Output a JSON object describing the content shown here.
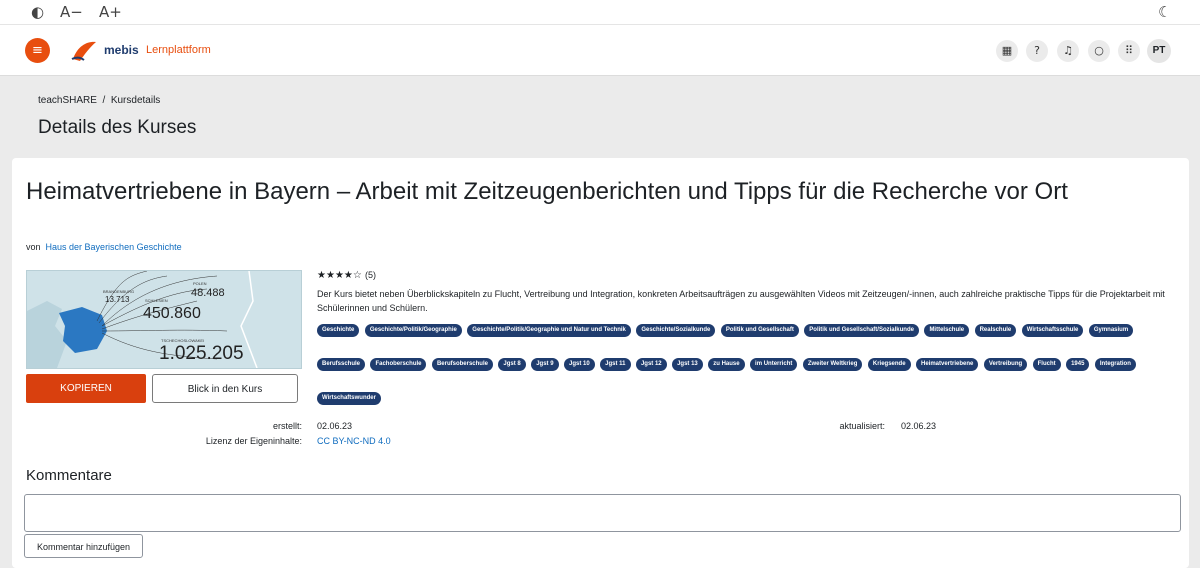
{
  "a11y": {
    "contrast_icon": "contrast-icon",
    "font_down": "A−",
    "font_up": "A+",
    "dark_mode_icon": "moon-icon"
  },
  "nav": {
    "menu_icon": "hamburger-icon",
    "brand": "mebis",
    "brand_sub": "Lernplattform",
    "icons": [
      "qr-code-icon",
      "help-icon",
      "bell-icon",
      "chat-icon",
      "apps-grid-icon"
    ],
    "user_initials": "PT"
  },
  "breadcrumb": {
    "first": "teachSHARE",
    "separator": "/",
    "current": "Kursdetails"
  },
  "page_title": "Details des Kurses",
  "course": {
    "title": "Heimatvertriebene in Bayern – Arbeit mit Zeitzeugenberichten und Tipps für die Recherche vor Ort",
    "by_label": "von",
    "author": "Haus der Bayerischen Geschichte",
    "thumbnail": {
      "labels": [
        "BRANDENBURG",
        "13.713",
        "POLEN",
        "48.488",
        "SCHLESIEN",
        "450.860",
        "TSCHECHOSLOWAKEI",
        "1.025.205"
      ]
    },
    "rating": {
      "value": 4,
      "max": 5,
      "count_text": "(5)"
    },
    "description": "Der Kurs bietet neben Überblickskapiteln zu Flucht, Vertreibung und Integration, konkreten Arbeitsaufträgen zu ausgewählten Videos mit Zeitzeugen/-innen, auch zahlreiche praktische Tipps für die Projektarbeit mit Schülerinnen und Schülern.",
    "tags": [
      "Geschichte",
      "Geschichte/Politik/Geographie",
      "Geschichte/Politik/Geographie und Natur und Technik",
      "Geschichte/Sozialkunde",
      "Politik und Gesellschaft",
      "Politik und Gesellschaft/Sozialkunde",
      "Mittelschule",
      "Realschule",
      "Wirtschaftsschule",
      "Gymnasium",
      "Berufsschule",
      "Fachoberschule",
      "Berufsoberschule",
      "Jgst 8",
      "Jgst 9",
      "Jgst 10",
      "Jgst 11",
      "Jgst 12",
      "Jgst 13",
      "zu Hause",
      "im Unterricht",
      "Zweiter Weltkrieg",
      "Kriegsende",
      "Heimatvertriebene",
      "Vertreibung",
      "Flucht",
      "1945",
      "Integration",
      "Wirtschaftswunder"
    ],
    "copy_button": "KOPIEREN",
    "view_button": "Blick in den Kurs",
    "created_label": "erstellt:",
    "created_value": "02.06.23",
    "updated_label": "aktualisiert:",
    "updated_value": "02.06.23",
    "license_label": "Lizenz der Eigeninhalte:",
    "license_value": "CC BY-NC-ND 4.0"
  },
  "comments": {
    "heading": "Kommentare",
    "add_button": "Kommentar hinzufügen"
  },
  "colors": {
    "accent": "#e84e0f",
    "tag_bg": "#1f3c6e",
    "link": "#0f6cbf"
  }
}
